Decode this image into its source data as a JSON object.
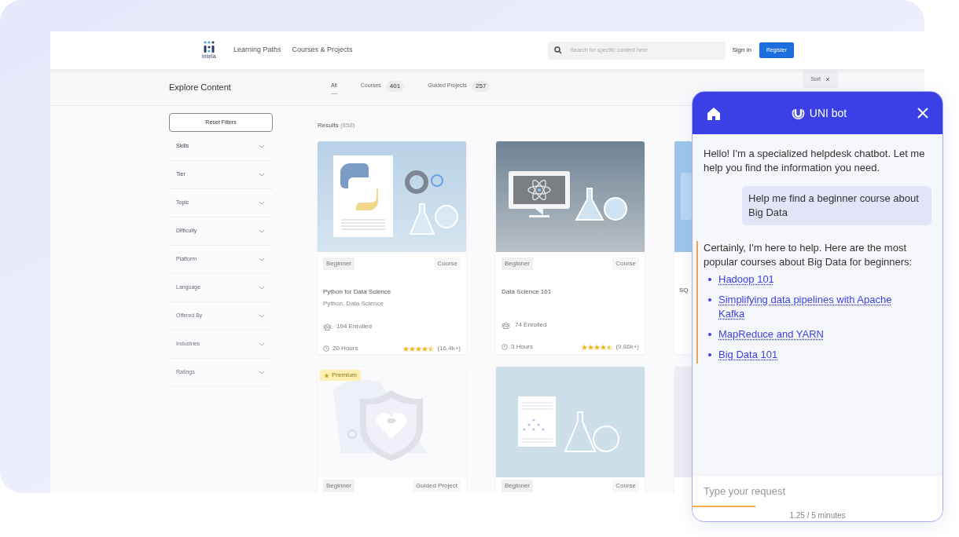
{
  "header": {
    "logo_text": "intela",
    "nav": [
      {
        "label": "Learning Paths"
      },
      {
        "label": "Courses & Projects"
      }
    ],
    "search": {
      "placeholder": "Search for specific content here"
    },
    "sign_in": "Sign in",
    "register": "Register"
  },
  "subbar": {
    "title": "Explore Content",
    "tabs": [
      {
        "label": "All",
        "selected": true
      },
      {
        "label": "Courses",
        "count": "401",
        "selected": false
      },
      {
        "label": "Guided Projects",
        "count": "257",
        "selected": false
      }
    ],
    "sort": "Sort"
  },
  "filters": {
    "reset": "Reset Filters",
    "items": [
      {
        "label": "Skills"
      },
      {
        "label": "Tier"
      },
      {
        "label": "Topic"
      },
      {
        "label": "Difficulty"
      },
      {
        "label": "Platform"
      },
      {
        "label": "Language"
      },
      {
        "label": "Offered By"
      },
      {
        "label": "Industries"
      },
      {
        "label": "Ratings"
      }
    ]
  },
  "results": {
    "label": "Results",
    "count": "(658)",
    "cards": [
      {
        "kind": "python",
        "level": "Beginner",
        "type": "Course",
        "title": "Python for Data Science",
        "tags": "Python, Data Science",
        "enrolled": "104 Enrolled",
        "hours": "20 Hours",
        "stars": 4.5,
        "reviews": "(16.4k+)"
      },
      {
        "kind": "science",
        "level": "Beginner",
        "type": "Course",
        "title": "Data Science 101",
        "enrolled": "74 Enrolled",
        "hours": "3 Hours",
        "stars": 4.5,
        "reviews": "(9.86k+)"
      },
      {
        "kind": "cut",
        "title": "SQ"
      },
      {
        "kind": "health",
        "badge": "Premium",
        "level": "Beginner",
        "type": "Guided Project"
      },
      {
        "kind": "stats",
        "level": "Beginner",
        "type": "Course"
      },
      {
        "kind": "cutblank"
      }
    ]
  },
  "chat": {
    "title": "UNI bot",
    "messages": [
      {
        "kind": "bot",
        "text": "Hello! I'm a specialized helpdesk chatbot. Let me help you find the information you need."
      },
      {
        "kind": "user",
        "text": "Help me find a beginner course about Big Data"
      },
      {
        "kind": "answer",
        "text": "Certainly, I'm here to help. Here are the most popular courses about Big Data for beginners:",
        "links": [
          "Hadoop 101",
          "Simplifying data pipelines with Apache Kafka",
          "MapReduce and YARN",
          "Big Data 101"
        ]
      }
    ],
    "input": {
      "placeholder": "Type your request"
    },
    "timer": {
      "level": 0.25,
      "text": "1.25 / 5 minutes"
    }
  }
}
